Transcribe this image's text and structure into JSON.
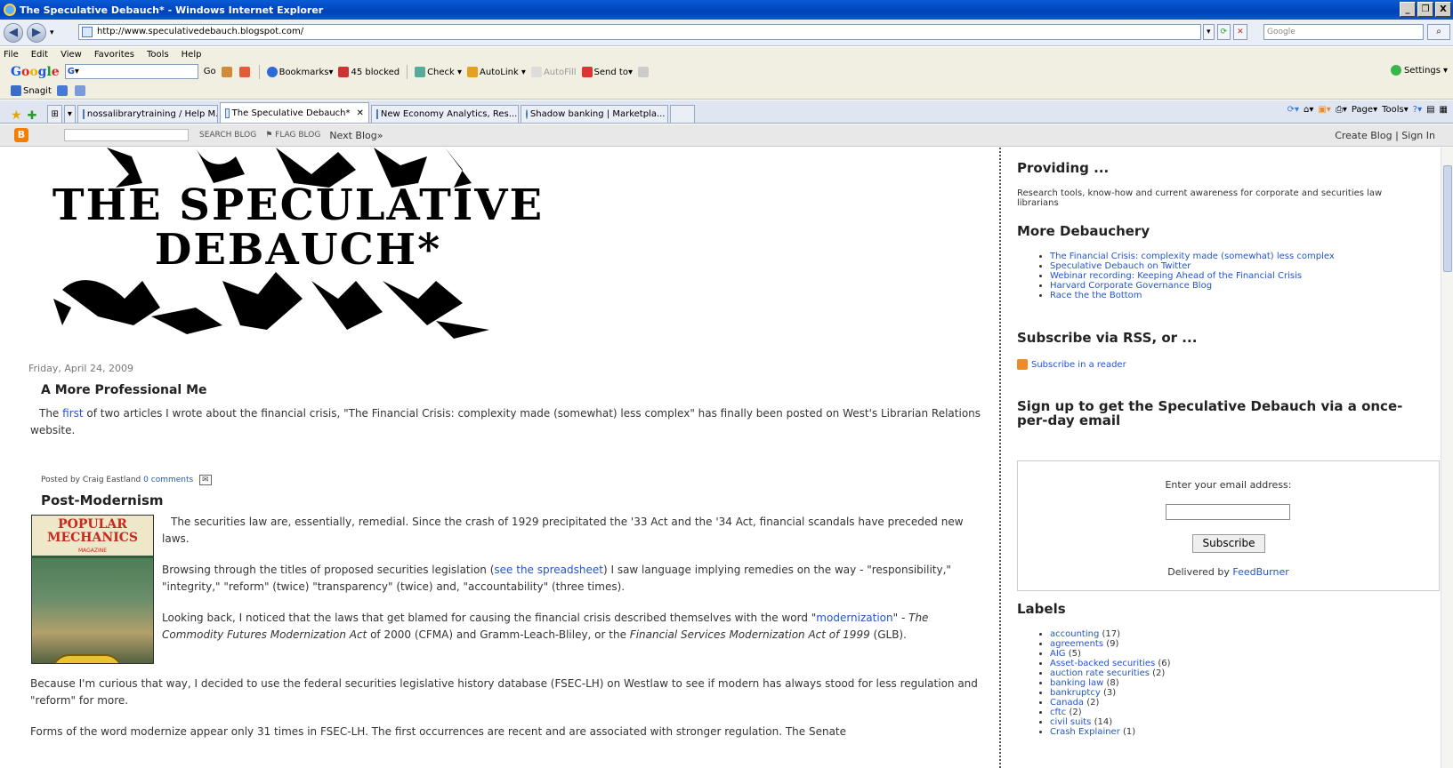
{
  "window": {
    "title": "The Speculative Debauch* - Windows Internet Explorer",
    "controls": [
      "_",
      "ə",
      "X"
    ]
  },
  "address": {
    "url": "http://www.speculativedebauch.blogspot.com/",
    "search_placeholder": "Google"
  },
  "menu": [
    "File",
    "Edit",
    "View",
    "Favorites",
    "Tools",
    "Help"
  ],
  "google_toolbar": {
    "go": "Go",
    "bookmarks": "Bookmarks",
    "blocked": "45 blocked",
    "check": "Check",
    "autolink": "AutoLink",
    "autofill": "AutoFill",
    "sendto": "Send to",
    "settings": "Settings"
  },
  "snagit": {
    "label": "Snagit"
  },
  "tabs": [
    {
      "label": "nossalibrarytraining / Help M...",
      "active": false
    },
    {
      "label": "The Speculative Debauch*",
      "active": true
    },
    {
      "label": "New Economy Analytics, Res...",
      "active": false
    },
    {
      "label": "Shadow banking | Marketpla...",
      "active": false
    }
  ],
  "command_bar": {
    "page": "Page",
    "tools": "Tools"
  },
  "blogger_bar": {
    "search": "SEARCH BLOG",
    "flag": "FLAG BLOG",
    "next": "Next Blog»",
    "create": "Create Blog",
    "signin": "Sign In",
    "sep": "|"
  },
  "blog": {
    "header_title": "THE SPECULATIVE DEBAUCH*",
    "header_line1": "THE SPECULATIVE",
    "header_line2": "DEBAUCH*",
    "date": "Friday, April 24, 2009",
    "post1": {
      "title": "A More Professional Me",
      "pre": "The ",
      "link": "first",
      "post": " of two articles I wrote about the financial crisis, \"The Financial Crisis: complexity made (somewhat) less complex\" has finally been posted on West's Librarian Relations website.",
      "posted_by": "Posted by Craig Eastland",
      "comments": "0 comments"
    },
    "post2": {
      "title": "Post-Modernism",
      "magazine_title": "POPULAR MECHANICS",
      "magazine_sub": "MAGAZINE",
      "p1": "The securities law are, essentially, remedial. Since the crash of 1929 precipitated the '33 Act and the '34 Act, financial scandals have preceded new laws.",
      "p2_pre": "Browsing through the titles of proposed securities legislation (",
      "p2_link": "see the spreadsheet",
      "p2_post": ") I saw language implying remedies on the way - \"responsibility,\" \"integrity,\" \"reform\" (twice) \"transparency\" (twice) and, \"accountability\" (three times).",
      "p3_a": "Looking back, I noticed that the laws that get blamed for causing the financial crisis described themselves with the word \"",
      "p3_link": "modernization",
      "p3_b": "\" - ",
      "p3_i1": "The Commodity Futures Modernization Act",
      "p3_c": " of 2000 (CFMA) and Gramm-Leach-Bliley, or the ",
      "p3_i2": "Financial Services Modernization Act of 1999",
      "p3_d": " (GLB).",
      "p4": "Because I'm curious that way, I decided to use the federal securities legislative history database (FSEC-LH) on Westlaw to see if modern has always stood for less regulation and \"reform\" for more.",
      "p5": "Forms of the word modernize appear only 31 times in FSEC-LH. The first occurrences are recent and are associated with stronger regulation. The Senate"
    }
  },
  "sidebar": {
    "providing_h": "Providing ...",
    "providing_t": "Research tools, know-how and current awareness for corporate and securities law librarians",
    "more_h": "More Debauchery",
    "more_links": [
      "The Financial Crisis: complexity made (somewhat) less complex",
      "Speculative Debauch on Twitter",
      "Webinar recording: Keeping Ahead of the Financial Crisis",
      "Harvard Corporate Governance Blog",
      "Race the the Bottom"
    ],
    "rss_h": "Subscribe via RSS, or ...",
    "rss_link": "Subscribe in a reader",
    "signup_h": "Sign up to get the Speculative Debauch via a once-per-day email",
    "email_label": "Enter your email address:",
    "subscribe": "Subscribe",
    "delivered_pre": "Delivered by ",
    "delivered_link": "FeedBurner",
    "labels_h": "Labels",
    "labels": [
      {
        "name": "accounting",
        "count": "(17)"
      },
      {
        "name": "agreements",
        "count": "(9)"
      },
      {
        "name": "AIG",
        "count": "(5)"
      },
      {
        "name": "Asset-backed securities",
        "count": "(6)"
      },
      {
        "name": "auction rate securities",
        "count": "(2)"
      },
      {
        "name": "banking law",
        "count": "(8)"
      },
      {
        "name": "bankruptcy",
        "count": "(3)"
      },
      {
        "name": "Canada",
        "count": "(2)"
      },
      {
        "name": "cftc",
        "count": "(2)"
      },
      {
        "name": "civil suits",
        "count": "(14)"
      },
      {
        "name": "Crash Explainer",
        "count": "(1)"
      }
    ]
  }
}
